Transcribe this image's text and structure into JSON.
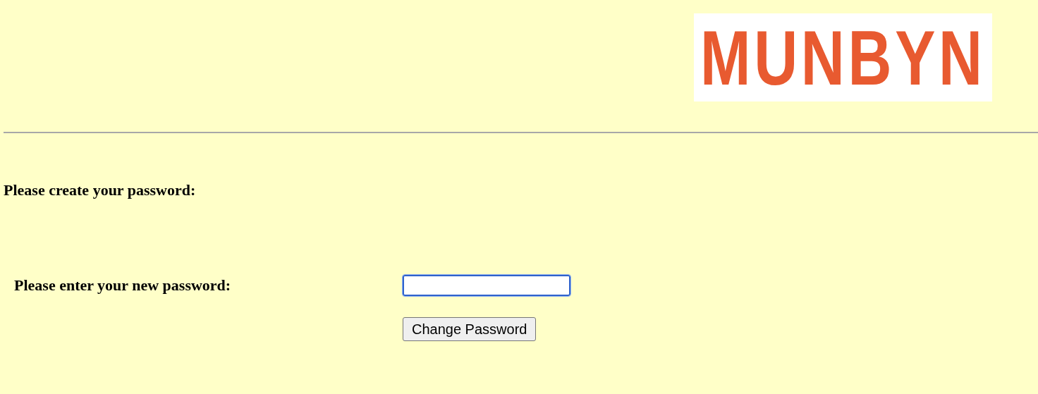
{
  "logo": {
    "text": "MUNBYN"
  },
  "heading": "Please create your password:",
  "form": {
    "label": "Please enter your new password:",
    "password_field": {
      "focused": true
    },
    "button": "Change Password"
  }
}
